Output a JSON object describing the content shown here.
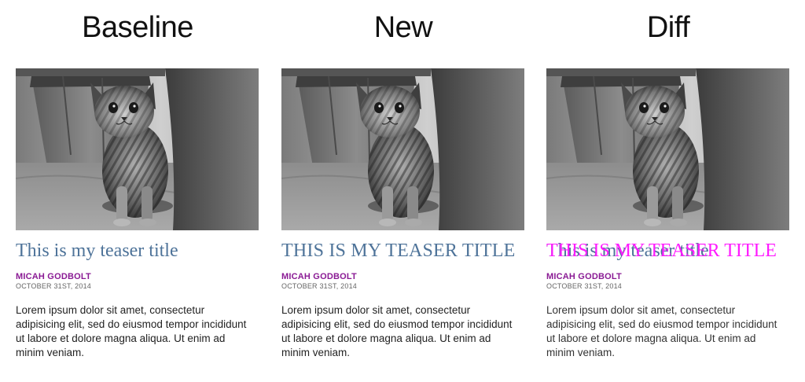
{
  "columns": [
    {
      "heading": "Baseline",
      "teaser_title": "This is my teaser title",
      "author": "MICAH GODBOLT",
      "date": "OCTOBER 31ST, 2014",
      "body": "Lorem ipsum dolor sit amet, consectetur adipisicing elit, sed do eiusmod tempor incididunt ut labore et dolore magna aliqua. Ut enim ad minim veniam."
    },
    {
      "heading": "New",
      "teaser_title": "THIS IS MY TEASER TITLE",
      "author": "MICAH GODBOLT",
      "date": "OCTOBER 31ST, 2014",
      "body": "Lorem ipsum dolor sit amet, consectetur adipisicing elit, sed do eiusmod tempor incididunt ut labore et dolore magna aliqua. Ut enim ad minim veniam."
    },
    {
      "heading": "Diff",
      "teaser_title_baseline": "This is my teaser title",
      "teaser_title_new": "THIS IS MY TEASER TITLE",
      "author": "MICAH GODBOLT",
      "date": "OCTOBER 31ST, 2014",
      "body": "Lorem ipsum dolor sit amet, consectetur adipisicing elit, sed do eiusmod tempor incididunt ut labore et dolore magna aliqua. Ut enim ad minim veniam."
    }
  ],
  "colors": {
    "title_blue": "#4e7399",
    "diff_magenta": "#ff1aff",
    "author_purple": "#8a1a94"
  },
  "image": {
    "subject": "kitten-photo"
  }
}
